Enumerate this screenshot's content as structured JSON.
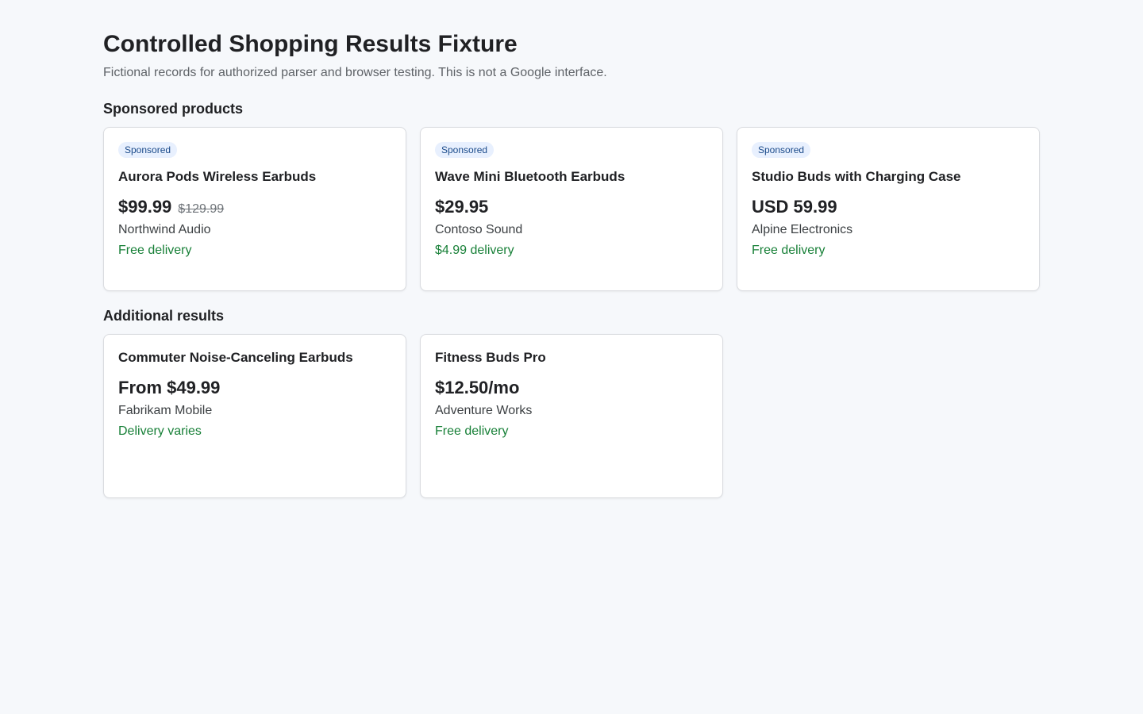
{
  "header": {
    "title": "Controlled Shopping Results Fixture",
    "subtitle": "Fictional records for authorized parser and browser testing. This is not a Google interface."
  },
  "sponsored": {
    "heading": "Sponsored products",
    "items": [
      {
        "badge": "Sponsored",
        "title": "Aurora Pods Wireless Earbuds",
        "price": "$99.99",
        "old_price": "$129.99",
        "merchant": "Northwind Audio",
        "delivery": "Free delivery"
      },
      {
        "badge": "Sponsored",
        "title": "Wave Mini Bluetooth Earbuds",
        "price": "$29.95",
        "old_price": "",
        "merchant": "Contoso Sound",
        "delivery": "$4.99 delivery"
      },
      {
        "badge": "Sponsored",
        "title": "Studio Buds with Charging Case",
        "price": "USD 59.99",
        "old_price": "",
        "merchant": "Alpine Electronics",
        "delivery": "Free delivery"
      }
    ]
  },
  "additional": {
    "heading": "Additional results",
    "items": [
      {
        "title": "Commuter Noise-Canceling Earbuds",
        "price": "From $49.99",
        "merchant": "Fabrikam Mobile",
        "delivery": "Delivery varies"
      },
      {
        "title": "Fitness Buds Pro",
        "price": "$12.50/mo",
        "merchant": "Adventure Works",
        "delivery": "Free delivery"
      }
    ]
  },
  "colors": {
    "background": "#f6f8fb",
    "badge_bg": "#e8f0fe",
    "badge_text": "#1a4a8a",
    "delivery_green": "#188038",
    "card_border": "#dadce0"
  }
}
